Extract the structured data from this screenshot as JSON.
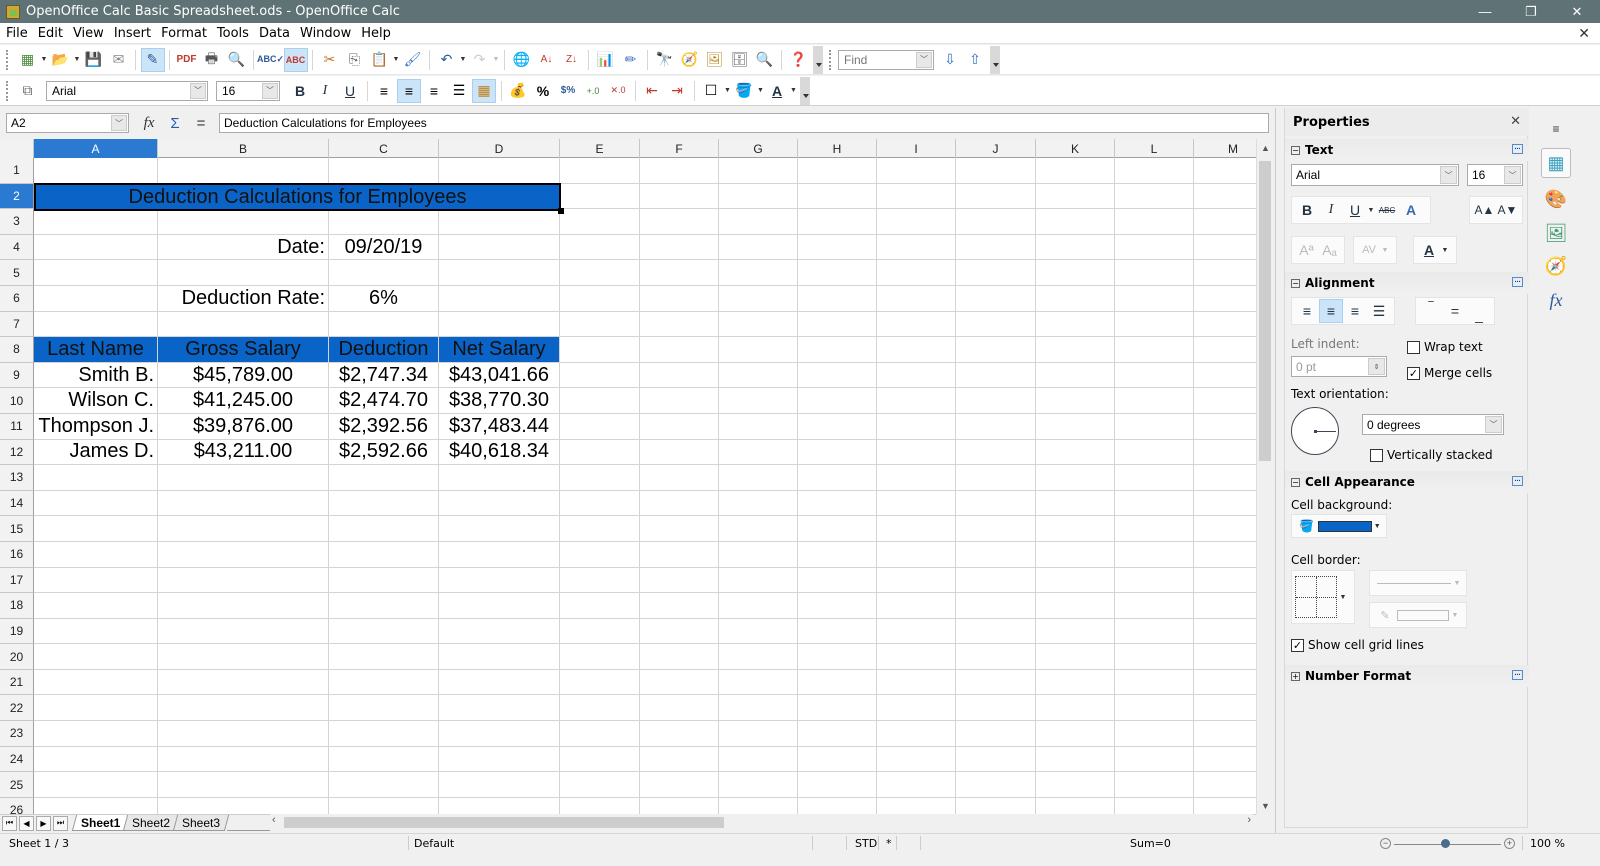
{
  "window": {
    "title": "OpenOffice Calc Basic Spreadsheet.ods - OpenOffice Calc",
    "minimize": "—",
    "restore": "❐",
    "close": "✕",
    "doc_close": "✕"
  },
  "menu": [
    "File",
    "Edit",
    "View",
    "Insert",
    "Format",
    "Tools",
    "Data",
    "Window",
    "Help"
  ],
  "toolbar": {
    "find_placeholder": "Find",
    "font_name": "Arial",
    "font_size": "16"
  },
  "formula_bar": {
    "cell_ref": "A2",
    "content": "Deduction Calculations for Employees",
    "fx": "fx",
    "sum": "Σ",
    "equals": "="
  },
  "columns": [
    "A",
    "B",
    "C",
    "D",
    "E",
    "F",
    "G",
    "H",
    "I",
    "J",
    "K",
    "L",
    "M"
  ],
  "selected_column": "A",
  "selected_row": 2,
  "sheet": {
    "title": "Deduction Calculations for Employees",
    "date_label": "Date:",
    "date_value": "09/20/19",
    "rate_label": "Deduction Rate:",
    "rate_value": "6%",
    "headers": [
      "Last Name",
      "Gross Salary",
      "Deduction",
      "Net Salary"
    ],
    "rows": [
      [
        "Smith B.",
        "$45,789.00",
        "$2,747.34",
        "$43,041.66"
      ],
      [
        "Wilson C.",
        "$41,245.00",
        "$2,474.70",
        "$38,770.30"
      ],
      [
        "Thompson J.",
        "$39,876.00",
        "$2,392.56",
        "$37,483.44"
      ],
      [
        "James D.",
        "$43,211.00",
        "$2,592.66",
        "$40,618.34"
      ]
    ],
    "header_fill": "#0a64c8"
  },
  "tabs": [
    "Sheet1",
    "Sheet2",
    "Sheet3"
  ],
  "active_tab": "Sheet1",
  "status": {
    "sheet": "Sheet 1 / 3",
    "style": "Default",
    "mode": "STD",
    "modified": "*",
    "sum": "Sum=0",
    "zoom": "100 %",
    "zoom_percent": 100
  },
  "sidebar": {
    "title": "Properties",
    "text_panel": {
      "title": "Text",
      "font_name": "Arial",
      "font_size": "16"
    },
    "alignment_panel": {
      "title": "Alignment",
      "left_indent_label": "Left indent:",
      "left_indent_value": "0 pt",
      "wrap_text": "Wrap text",
      "wrap_text_checked": false,
      "merge_cells": "Merge cells",
      "merge_cells_checked": true,
      "text_orientation_label": "Text orientation:",
      "orientation_value": "0 degrees",
      "vertically_stacked": "Vertically stacked",
      "vertically_stacked_checked": false
    },
    "cell_appearance_panel": {
      "title": "Cell Appearance",
      "background_label": "Cell background:",
      "background_color": "#0a64c8",
      "border_label": "Cell border:",
      "show_grid": "Show cell grid lines",
      "show_grid_checked": true
    },
    "number_format_panel": {
      "title": "Number Format"
    }
  }
}
